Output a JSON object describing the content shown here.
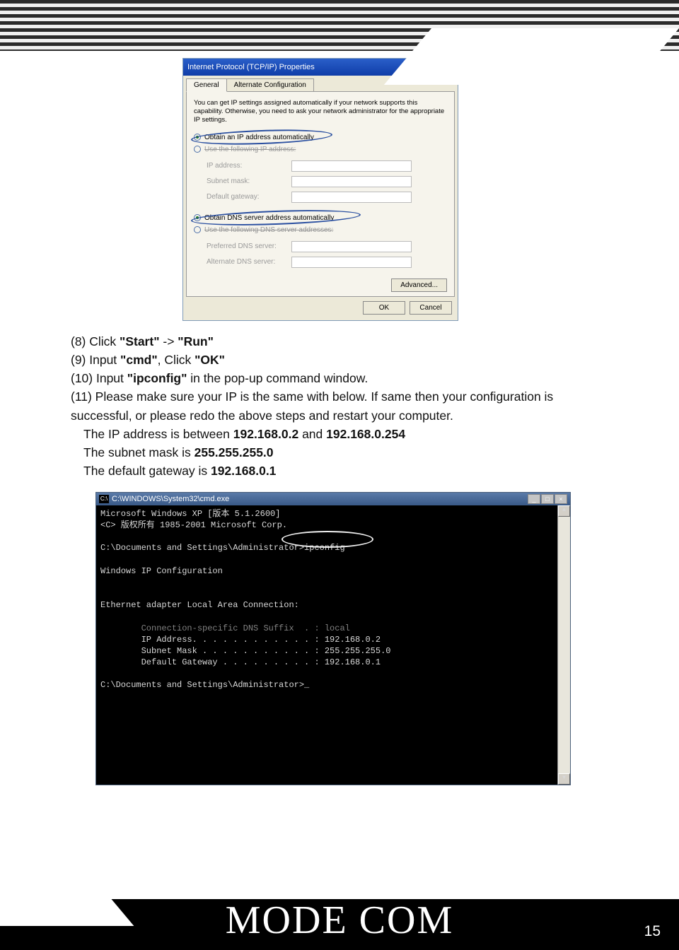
{
  "dialog": {
    "title": "Internet Protocol (TCP/IP) Properties",
    "tabs": {
      "general": "General",
      "alt": "Alternate Configuration"
    },
    "description": "You can get IP settings assigned automatically if your network supports this capability. Otherwise, you need to ask your network administrator for the appropriate IP settings.",
    "radio1": "Obtain an IP address automatically",
    "radio2": "Use the following IP address:",
    "fields1": {
      "ip": "IP address:",
      "subnet": "Subnet mask:",
      "gateway": "Default gateway:"
    },
    "radio3": "Obtain DNS server address automatically",
    "radio4": "Use the following DNS server addresses:",
    "fields2": {
      "pref": "Preferred DNS server:",
      "alt": "Alternate DNS server:"
    },
    "advanced": "Advanced...",
    "ok": "OK",
    "cancel": "Cancel"
  },
  "instructions": {
    "line8_a": "(8) Click ",
    "line8_b": "\"Start\"",
    "line8_c": " -> ",
    "line8_d": "\"Run\"",
    "line9_a": "(9) Input ",
    "line9_b": "\"cmd\"",
    "line9_c": ", Click ",
    "line9_d": "\"OK\"",
    "line10_a": "(10) Input ",
    "line10_b": "\"ipconfig\"",
    "line10_c": " in the pop-up command window.",
    "line11": "(11) Please make sure your IP is the same with below. If same then your configuration is successful, or please redo the above steps and restart your computer.",
    "ip_a": "The IP address is between ",
    "ip_b": "192.168.0.2",
    "ip_c": " and ",
    "ip_d": "192.168.0.254",
    "subnet_a": "The subnet mask is ",
    "subnet_b": "255.255.255.0",
    "gw_a": "The default gateway is ",
    "gw_b": "192.168.0.1"
  },
  "cmd": {
    "title": "C:\\WINDOWS\\System32\\cmd.exe",
    "l1": "Microsoft Windows XP [版本 5.1.2600]",
    "l2": "<C> 版权所有 1985-2001 Microsoft Corp.",
    "l3": "C:\\Documents and Settings\\Administrator>ipconfig",
    "l4": "Windows IP Configuration",
    "l5": "Ethernet adapter Local Area Connection:",
    "l6": "        Connection-specific DNS Suffix  . : local",
    "l7": "        IP Address. . . . . . . . . . . . : 192.168.0.2",
    "l8": "        Subnet Mask . . . . . . . . . . . : 255.255.255.0",
    "l9": "        Default Gateway . . . . . . . . . : 192.168.0.1",
    "l10": "C:\\Documents and Settings\\Administrator>_"
  },
  "footer": {
    "brand": "MODE COM",
    "page": "15"
  }
}
